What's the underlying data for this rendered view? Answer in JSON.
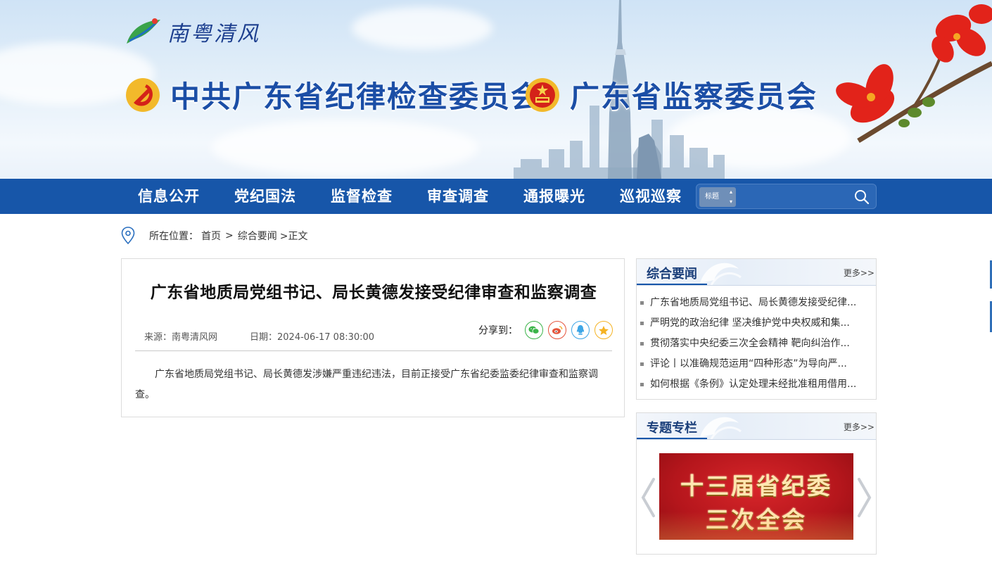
{
  "header": {
    "logo_text": "南粤清风",
    "org_left": "中共广东省纪律检查委员会",
    "org_right": "广东省监察委员会"
  },
  "nav": {
    "items": [
      "信息公开",
      "党纪国法",
      "监督检查",
      "审查调查",
      "通报曝光",
      "巡视巡察"
    ],
    "search": {
      "select_label": "标题",
      "value": ""
    }
  },
  "breadcrumb": {
    "label": "所在位置：",
    "home": "首页",
    "sep1": ">",
    "section": "综合要闻",
    "current": ">正文"
  },
  "article": {
    "title": "广东省地质局党组书记、局长黄德发接受纪律审查和监察调查",
    "source": "来源：南粤清风网",
    "date": "日期：2024-06-17 08:30:00",
    "share_label": "分享到：",
    "share_buttons": [
      "wechat-icon",
      "weibo-icon",
      "qq-icon",
      "qzone-icon"
    ],
    "body": "广东省地质局党组书记、局长黄德发涉嫌严重违纪违法，目前正接受广东省纪委监委纪律审查和监察调查。"
  },
  "news_panel": {
    "title": "综合要闻",
    "more": "更多>>",
    "items": [
      "广东省地质局党组书记、局长黄德发接受纪律...",
      "严明党的政治纪律 坚决维护党中央权威和集...",
      "贯彻落实中央纪委三次全会精神 靶向纠治作...",
      "评论丨以准确规范运用“四种形态”为导向严...",
      "如何根据《条例》认定处理未经批准租用借用..."
    ]
  },
  "topic_panel": {
    "title": "专题专栏",
    "more": "更多>>",
    "slide_line1": "十三届省纪委",
    "slide_line2": "三次全会"
  },
  "colors": {
    "nav_bg": "#1756a9",
    "title_blue": "#1b4ea6",
    "accent_red": "#c8161d"
  }
}
